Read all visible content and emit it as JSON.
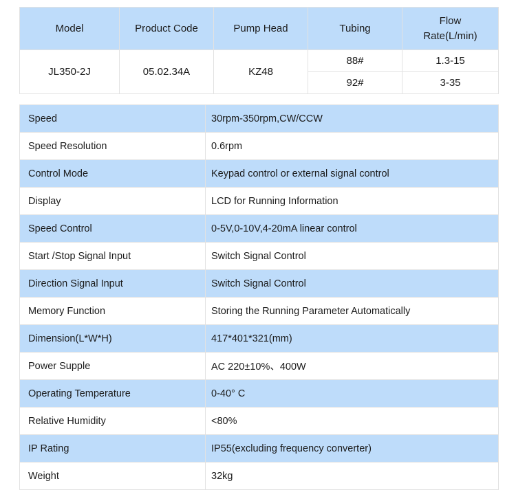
{
  "model_table": {
    "headers": [
      "Model",
      "Product Code",
      "Pump Head",
      "Tubing",
      "Flow\nRate(L/min)"
    ],
    "header_lines": {
      "flow_rate_line1": "Flow",
      "flow_rate_line2": "Rate(L/min)"
    },
    "row": {
      "model": "JL350-2J",
      "product_code": "05.02.34A",
      "pump_head": "KZ48",
      "variants": [
        {
          "tubing": "88#",
          "flow_rate": "1.3-15"
        },
        {
          "tubing": "92#",
          "flow_rate": "3-35"
        }
      ]
    }
  },
  "spec_table": {
    "rows": [
      {
        "label": "Speed",
        "value": "30rpm-350rpm,CW/CCW"
      },
      {
        "label": "Speed Resolution",
        "value": "0.6rpm"
      },
      {
        "label": "Control Mode",
        "value": "Keypad control or external signal control"
      },
      {
        "label": "Display",
        "value": "LCD for Running Information"
      },
      {
        "label": "Speed Control",
        "value": "0-5V,0-10V,4-20mA linear control"
      },
      {
        "label": "Start /Stop Signal Input",
        "value": "Switch Signal Control"
      },
      {
        "label": "Direction Signal Input",
        "value": "Switch Signal Control"
      },
      {
        "label": "Memory Function",
        "value": "Storing the Running Parameter Automatically"
      },
      {
        "label": "Dimension(L*W*H)",
        "value": "417*401*321(mm)"
      },
      {
        "label": "Power Supple",
        "value": "AC 220±10%、400W"
      },
      {
        "label": "Operating Temperature",
        "value": "0-40° C"
      },
      {
        "label": "Relative Humidity",
        "value": "<80%"
      },
      {
        "label": "IP Rating",
        "value": "IP55(excluding frequency converter)"
      },
      {
        "label": "Weight",
        "value": "32kg"
      }
    ]
  },
  "colors": {
    "header_blue": "#bedcfa",
    "row_blue": "#bedcfa",
    "row_white": "#ffffff",
    "border_gray": "#e2e2e2",
    "text": "#1b1b1b"
  }
}
